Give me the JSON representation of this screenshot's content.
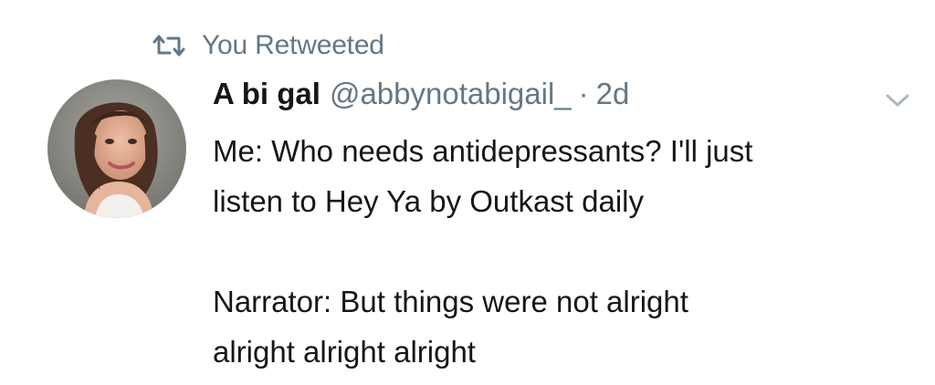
{
  "tweet": {
    "retweet_context": "You Retweeted",
    "author": {
      "display_name": "A bi gal",
      "handle": "@abbynotabigail_",
      "separator": "·",
      "timestamp": "2d"
    },
    "text_lines": [
      "Me: Who needs antidepressants? I'll just",
      "listen to Hey Ya by Outkast daily",
      "",
      "Narrator: But things were not alright",
      "alright alright alright"
    ]
  },
  "icons": {
    "retweet": "retweet-icon",
    "menu": "chevron-down-icon",
    "avatar": "profile-avatar"
  },
  "colors": {
    "secondary_text": "#657786",
    "primary_text": "#14171a",
    "background": "#ffffff"
  }
}
